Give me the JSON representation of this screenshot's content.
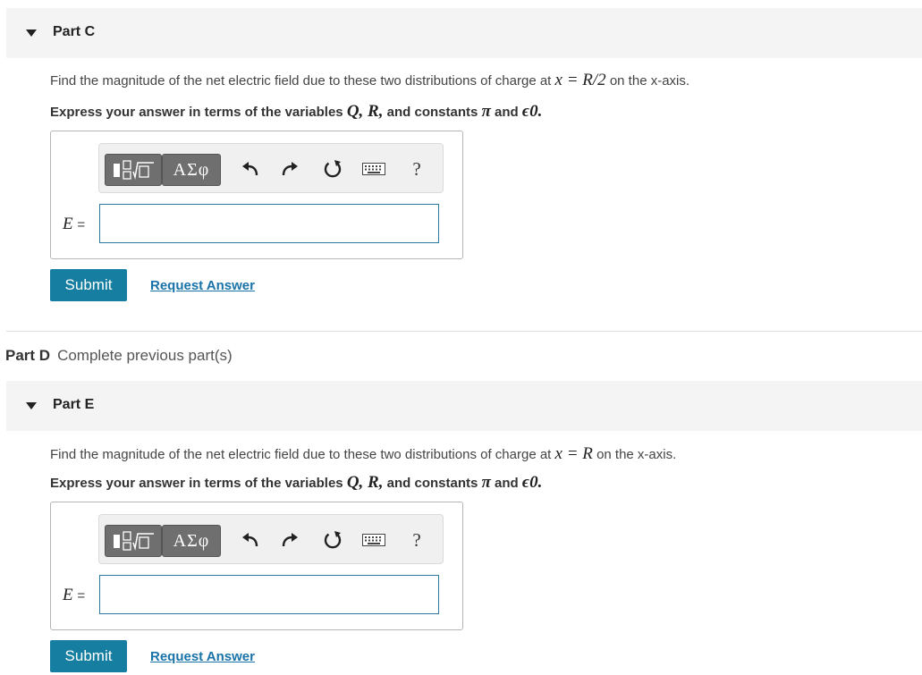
{
  "part_c": {
    "title": "Part C",
    "question_prefix": "Find the magnitude of the net electric field due to these two distributions of charge at",
    "question_math": "x = R/2",
    "question_suffix": "on the x-axis.",
    "instruction_prefix": "Express your answer in terms of the variables",
    "instruction_vars": "Q, R,",
    "instruction_mid": "and constants",
    "instruction_pi": "π",
    "instruction_and": "and",
    "instruction_eps": "ϵ0.",
    "answer_label": "E",
    "answer_eq": "=",
    "answer_value": "",
    "submit_label": "Submit",
    "request_label": "Request Answer"
  },
  "part_d": {
    "label": "Part D",
    "message": "Complete previous part(s)"
  },
  "part_e": {
    "title": "Part E",
    "question_prefix": "Find the magnitude of the net electric field due to these two distributions of charge at",
    "question_math": "x = R",
    "question_suffix": "on the x-axis.",
    "instruction_prefix": "Express your answer in terms of the variables",
    "instruction_vars": "Q, R,",
    "instruction_mid": "and constants",
    "instruction_pi": "π",
    "instruction_and": "and",
    "instruction_eps": "ϵ0.",
    "answer_label": "E",
    "answer_eq": "=",
    "answer_value": "",
    "submit_label": "Submit",
    "request_label": "Request Answer"
  },
  "toolbar": {
    "greek_label": "ΑΣφ",
    "help_label": "?",
    "icons": [
      "templates-icon",
      "greek-symbols-icon",
      "undo-icon",
      "redo-icon",
      "reset-icon",
      "keyboard-icon",
      "help-icon"
    ]
  }
}
